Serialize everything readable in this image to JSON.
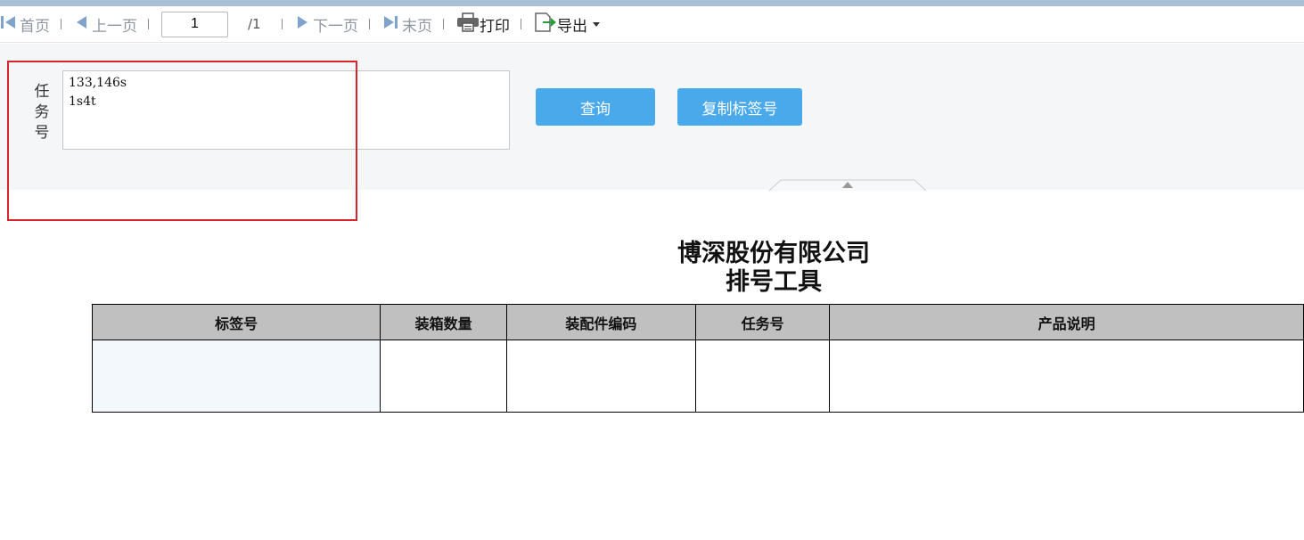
{
  "toolbar": {
    "first_label": "首页",
    "prev_label": "上一页",
    "page_value": "1",
    "page_total": "/1",
    "next_label": "下一页",
    "last_label": "末页",
    "print_label": "打印",
    "export_label": "导出"
  },
  "query": {
    "task_label": "任务号",
    "task_value": "133,146s\n1s4t",
    "query_button": "查询",
    "copy_button": "复制标签号"
  },
  "report": {
    "company": "博深股份有限公司",
    "tool_name": "排号工具",
    "columns": [
      "标签号",
      "装箱数量",
      "装配件编码",
      "任务号",
      "产品说明"
    ]
  },
  "colors": {
    "button": "#49a9eb",
    "highlight": "#d9242c",
    "header_bg": "#c0c0c0",
    "panel_bg": "#f5f6f8"
  },
  "icons": [
    "first-page-icon",
    "prev-page-icon",
    "next-page-icon",
    "last-page-icon",
    "printer-icon",
    "export-icon",
    "caret-down-icon",
    "collapse-arrow-icon"
  ]
}
